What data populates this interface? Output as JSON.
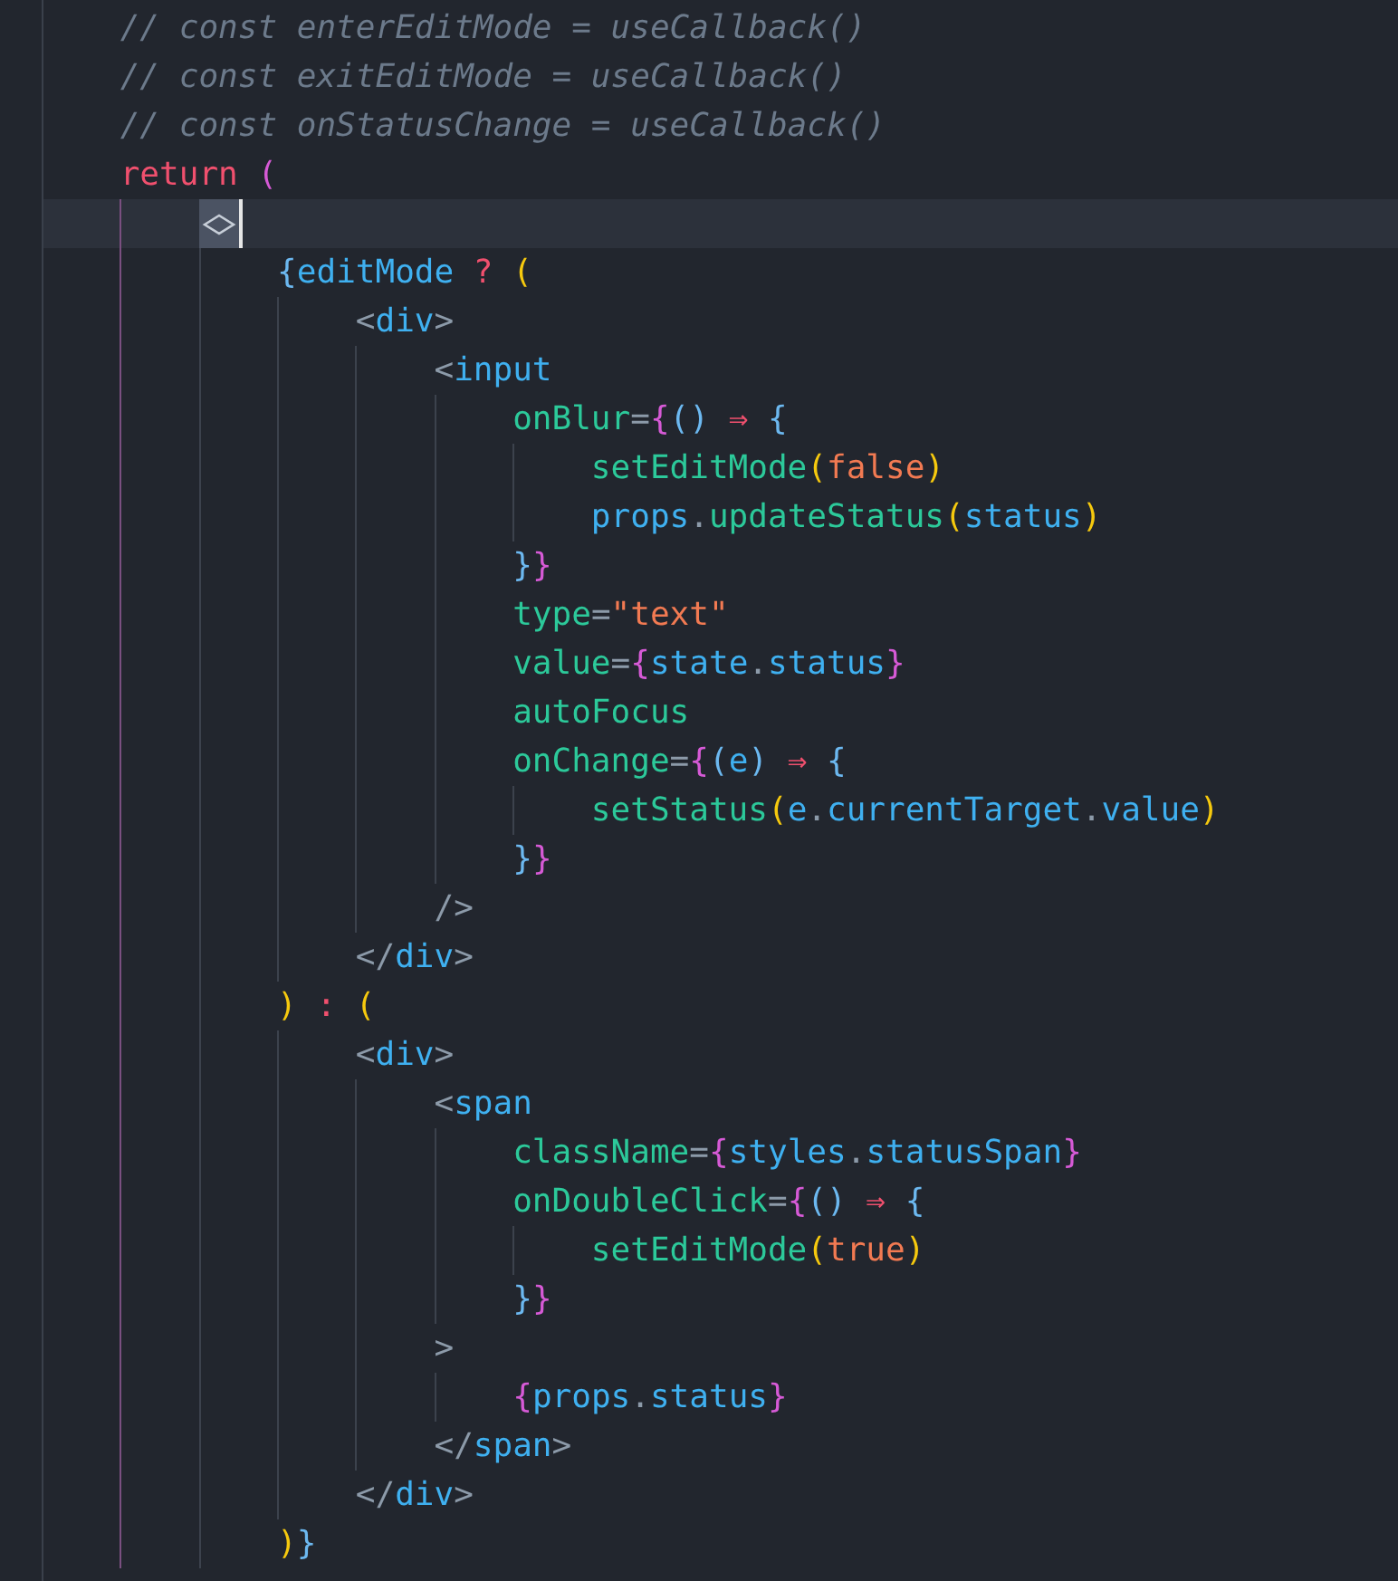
{
  "editor": {
    "lines": [
      {
        "current": false,
        "tokens": [
          {
            "text": "    // const enterEditMode = useCallback()",
            "kind": "comment"
          }
        ]
      },
      {
        "current": false,
        "tokens": [
          {
            "text": "    // const exitEditMode = useCallback()",
            "kind": "comment"
          }
        ]
      },
      {
        "current": false,
        "tokens": [
          {
            "text": "    // const onStatusChange = useCallback()",
            "kind": "comment"
          }
        ]
      },
      {
        "current": false,
        "tokens": [
          {
            "text": "    return ",
            "kind": "keyword"
          },
          {
            "text": "(",
            "kind": "bracket2"
          }
        ]
      },
      {
        "current": true
      },
      {
        "current": false,
        "tokens": [
          {
            "text": "            {",
            "kind": "bracket3"
          },
          {
            "text": "editMode",
            "kind": "variable"
          },
          {
            "text": " ? ",
            "kind": "keyword"
          },
          {
            "text": "(",
            "kind": "bracket1"
          }
        ]
      },
      {
        "current": false,
        "tokens": [
          {
            "text": "                <",
            "kind": "tagpunct"
          },
          {
            "text": "div",
            "kind": "tag"
          },
          {
            "text": ">",
            "kind": "tagpunct"
          }
        ]
      },
      {
        "current": false,
        "tokens": [
          {
            "text": "                    <",
            "kind": "tagpunct"
          },
          {
            "text": "input",
            "kind": "tag"
          }
        ]
      },
      {
        "current": false,
        "tokens": [
          {
            "text": "                        onBlur",
            "kind": "attribute"
          },
          {
            "text": "=",
            "kind": "operator"
          },
          {
            "text": "{",
            "kind": "bracket2"
          },
          {
            "text": "()",
            "kind": "bracket3"
          },
          {
            "text": " ⇒ ",
            "kind": "keyword"
          },
          {
            "text": "{",
            "kind": "bracket3"
          }
        ]
      },
      {
        "current": false,
        "tokens": [
          {
            "text": "                            setEditMode",
            "kind": "function"
          },
          {
            "text": "(",
            "kind": "bracket1"
          },
          {
            "text": "false",
            "kind": "literal"
          },
          {
            "text": ")",
            "kind": "bracket1"
          }
        ]
      },
      {
        "current": false,
        "tokens": [
          {
            "text": "                            props",
            "kind": "variable"
          },
          {
            "text": ".",
            "kind": "operator"
          },
          {
            "text": "updateStatus",
            "kind": "function"
          },
          {
            "text": "(",
            "kind": "bracket1"
          },
          {
            "text": "status",
            "kind": "variable"
          },
          {
            "text": ")",
            "kind": "bracket1"
          }
        ]
      },
      {
        "current": false,
        "tokens": [
          {
            "text": "                        }",
            "kind": "bracket3"
          },
          {
            "text": "}",
            "kind": "bracket2"
          }
        ]
      },
      {
        "current": false,
        "tokens": [
          {
            "text": "                        type",
            "kind": "attribute"
          },
          {
            "text": "=",
            "kind": "operator"
          },
          {
            "text": "\"text\"",
            "kind": "string"
          }
        ]
      },
      {
        "current": false,
        "tokens": [
          {
            "text": "                        value",
            "kind": "attribute"
          },
          {
            "text": "=",
            "kind": "operator"
          },
          {
            "text": "{",
            "kind": "bracket2"
          },
          {
            "text": "state",
            "kind": "variable"
          },
          {
            "text": ".",
            "kind": "operator"
          },
          {
            "text": "status",
            "kind": "variable"
          },
          {
            "text": "}",
            "kind": "bracket2"
          }
        ]
      },
      {
        "current": false,
        "tokens": [
          {
            "text": "                        autoFocus",
            "kind": "attribute"
          }
        ]
      },
      {
        "current": false,
        "tokens": [
          {
            "text": "                        onChange",
            "kind": "attribute"
          },
          {
            "text": "=",
            "kind": "operator"
          },
          {
            "text": "{",
            "kind": "bracket2"
          },
          {
            "text": "(",
            "kind": "bracket3"
          },
          {
            "text": "e",
            "kind": "variable"
          },
          {
            "text": ")",
            "kind": "bracket3"
          },
          {
            "text": " ⇒ ",
            "kind": "keyword"
          },
          {
            "text": "{",
            "kind": "bracket3"
          }
        ]
      },
      {
        "current": false,
        "tokens": [
          {
            "text": "                            setStatus",
            "kind": "function"
          },
          {
            "text": "(",
            "kind": "bracket1"
          },
          {
            "text": "e",
            "kind": "variable"
          },
          {
            "text": ".",
            "kind": "operator"
          },
          {
            "text": "currentTarget",
            "kind": "variable"
          },
          {
            "text": ".",
            "kind": "operator"
          },
          {
            "text": "value",
            "kind": "variable"
          },
          {
            "text": ")",
            "kind": "bracket1"
          }
        ]
      },
      {
        "current": false,
        "tokens": [
          {
            "text": "                        }",
            "kind": "bracket3"
          },
          {
            "text": "}",
            "kind": "bracket2"
          }
        ]
      },
      {
        "current": false,
        "tokens": [
          {
            "text": "                    />",
            "kind": "tagpunct"
          }
        ]
      },
      {
        "current": false,
        "tokens": [
          {
            "text": "                </",
            "kind": "tagpunct"
          },
          {
            "text": "div",
            "kind": "tag"
          },
          {
            "text": ">",
            "kind": "tagpunct"
          }
        ]
      },
      {
        "current": false,
        "tokens": [
          {
            "text": "            )",
            "kind": "bracket1"
          },
          {
            "text": " : ",
            "kind": "keyword"
          },
          {
            "text": "(",
            "kind": "bracket1"
          }
        ]
      },
      {
        "current": false,
        "tokens": [
          {
            "text": "                <",
            "kind": "tagpunct"
          },
          {
            "text": "div",
            "kind": "tag"
          },
          {
            "text": ">",
            "kind": "tagpunct"
          }
        ]
      },
      {
        "current": false,
        "tokens": [
          {
            "text": "                    <",
            "kind": "tagpunct"
          },
          {
            "text": "span",
            "kind": "tag"
          }
        ]
      },
      {
        "current": false,
        "tokens": [
          {
            "text": "                        className",
            "kind": "attribute"
          },
          {
            "text": "=",
            "kind": "operator"
          },
          {
            "text": "{",
            "kind": "bracket2"
          },
          {
            "text": "styles",
            "kind": "variable"
          },
          {
            "text": ".",
            "kind": "operator"
          },
          {
            "text": "statusSpan",
            "kind": "variable"
          },
          {
            "text": "}",
            "kind": "bracket2"
          }
        ]
      },
      {
        "current": false,
        "tokens": [
          {
            "text": "                        onDoubleClick",
            "kind": "attribute"
          },
          {
            "text": "=",
            "kind": "operator"
          },
          {
            "text": "{",
            "kind": "bracket2"
          },
          {
            "text": "()",
            "kind": "bracket3"
          },
          {
            "text": " ⇒ ",
            "kind": "keyword"
          },
          {
            "text": "{",
            "kind": "bracket3"
          }
        ]
      },
      {
        "current": false,
        "tokens": [
          {
            "text": "                            setEditMode",
            "kind": "function"
          },
          {
            "text": "(",
            "kind": "bracket1"
          },
          {
            "text": "true",
            "kind": "literal"
          },
          {
            "text": ")",
            "kind": "bracket1"
          }
        ]
      },
      {
        "current": false,
        "tokens": [
          {
            "text": "                        }",
            "kind": "bracket3"
          },
          {
            "text": "}",
            "kind": "bracket2"
          }
        ]
      },
      {
        "current": false,
        "tokens": [
          {
            "text": "                    >",
            "kind": "tagpunct"
          }
        ]
      },
      {
        "current": false,
        "tokens": [
          {
            "text": "                        {",
            "kind": "bracket2"
          },
          {
            "text": "props",
            "kind": "variable"
          },
          {
            "text": ".",
            "kind": "operator"
          },
          {
            "text": "status",
            "kind": "variable"
          },
          {
            "text": "}",
            "kind": "bracket2"
          }
        ]
      },
      {
        "current": false,
        "tokens": [
          {
            "text": "                    </",
            "kind": "tagpunct"
          },
          {
            "text": "span",
            "kind": "tag"
          },
          {
            "text": ">",
            "kind": "tagpunct"
          }
        ]
      },
      {
        "current": false,
        "tokens": [
          {
            "text": "                </",
            "kind": "tagpunct"
          },
          {
            "text": "div",
            "kind": "tag"
          },
          {
            "text": ">",
            "kind": "tagpunct"
          }
        ]
      },
      {
        "current": false,
        "tokens": [
          {
            "text": "            )",
            "kind": "bracket1"
          },
          {
            "text": "}",
            "kind": "bracket3"
          }
        ]
      }
    ]
  }
}
